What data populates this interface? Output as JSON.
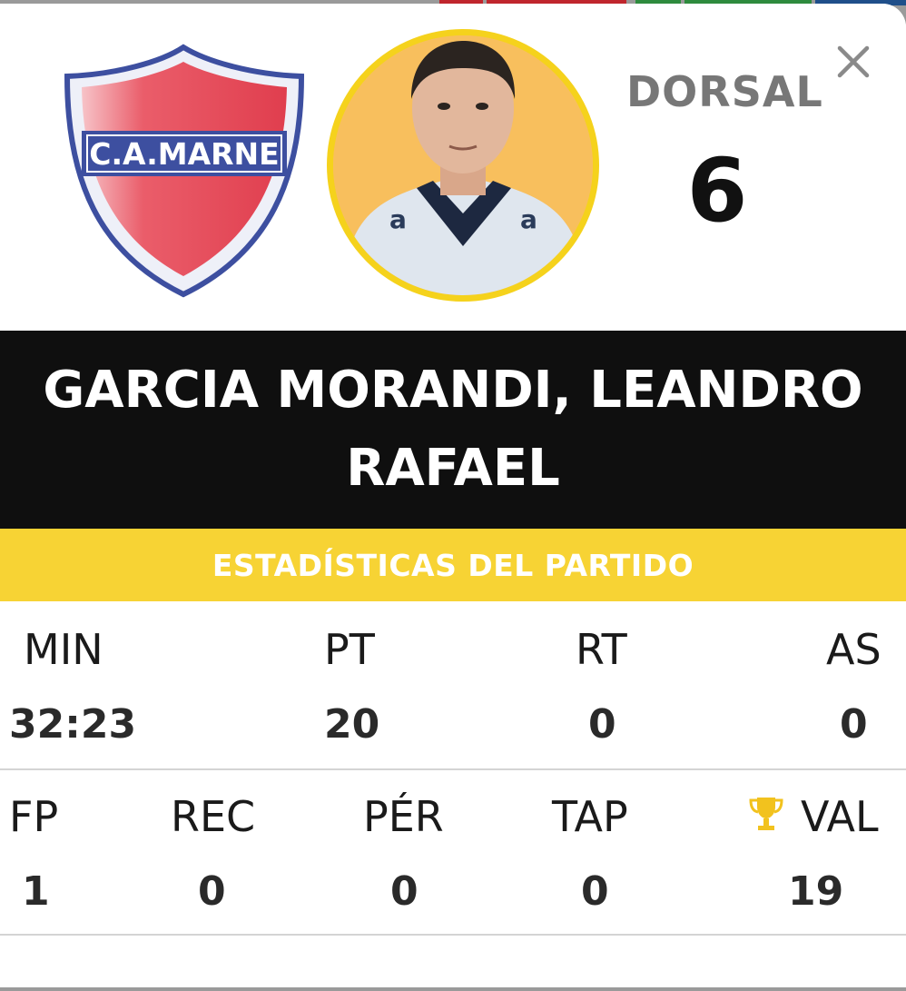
{
  "team": {
    "logo_text": "C.A.MARNE"
  },
  "player": {
    "dorsal_label": "DORSAL",
    "dorsal_number": "6",
    "name": "GARCIA MORANDI, LEANDRO RAFAEL"
  },
  "stats_title": "ESTADÍSTICAS DEL PARTIDO",
  "row1": [
    {
      "label": "MIN",
      "value": "32:23"
    },
    {
      "label": "PT",
      "value": "20"
    },
    {
      "label": "RT",
      "value": "0"
    },
    {
      "label": "AS",
      "value": "0"
    }
  ],
  "row2": [
    {
      "label": "FP",
      "value": "1"
    },
    {
      "label": "REC",
      "value": "0"
    },
    {
      "label": "PÉR",
      "value": "0"
    },
    {
      "label": "TAP",
      "value": "0"
    },
    {
      "label": "VAL",
      "value": "19",
      "icon": "trophy-icon"
    }
  ],
  "colors": {
    "accent_yellow": "#f7d334",
    "name_bar": "#0f0f0f",
    "shield_red": "#e84a5a",
    "shield_blue": "#3d4fa0"
  }
}
